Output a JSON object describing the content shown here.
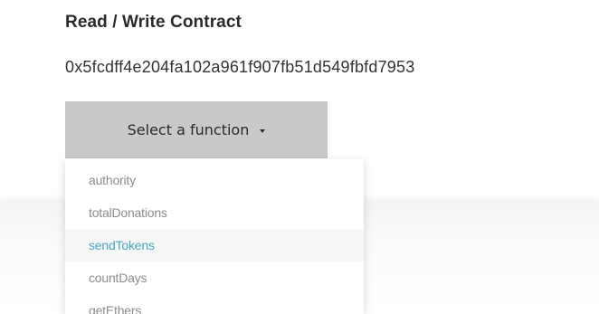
{
  "section": {
    "title": "Read / Write Contract",
    "address": "0x5fcdff4e204fa102a961f907fb51d549fbfd7953"
  },
  "select": {
    "label": "Select a function"
  },
  "functions": [
    {
      "label": "authority"
    },
    {
      "label": "totalDonations"
    },
    {
      "label": "sendTokens",
      "highlighted": true
    },
    {
      "label": "countDays"
    },
    {
      "label": "getEthers"
    }
  ],
  "colors": {
    "button_bg": "#c9c9c9",
    "highlight_text": "#4aa6c0",
    "item_text": "#8c8c8c"
  }
}
